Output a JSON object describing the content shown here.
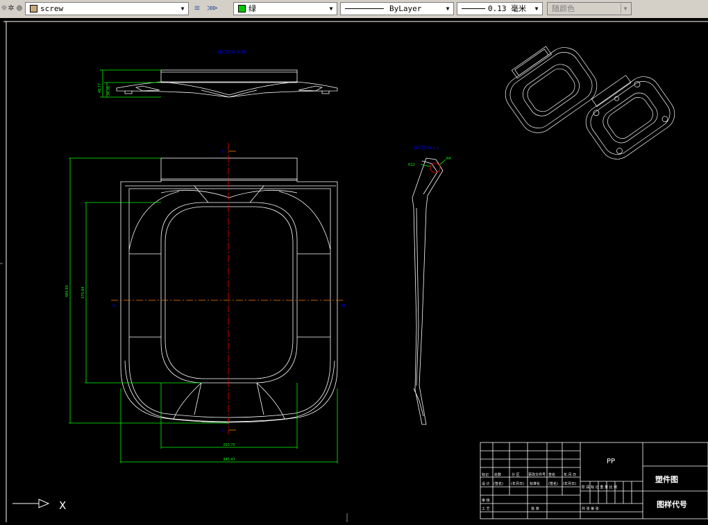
{
  "toolbar": {
    "layer_name": "screw",
    "layer_color_hex": "#c8a878",
    "color_name": "绿",
    "color_swatch_hex": "#00c800",
    "linetype": "ByLayer",
    "lineweight": "0.13 毫米",
    "plotstyle": "随颜色"
  },
  "drawing": {
    "section_mm_label": "SECTION M-M",
    "section_ll_label": "SECTION L-L",
    "dim_48_77": "48.77",
    "dim_34_36": "34.36",
    "dim_484_90": "484.90",
    "dim_370_84": "370.84",
    "dim_250_75": "250.75",
    "dim_345_47": "345.47",
    "dim_r4": "R4",
    "dim_r12": "R12",
    "marker_l": "L",
    "marker_m": "M",
    "colors": {
      "white": "#ffffff",
      "green": "#00ff00",
      "blue": "#0000ff",
      "red": "#ff0000",
      "orange": "#ff7f00"
    }
  },
  "title_block": {
    "part_name": "PP",
    "drawing_type": "塑件图",
    "drawing_code_label": "图样代号",
    "small_row1": [
      "标记",
      "处数",
      "分 区",
      "更改文件号",
      "签名",
      "年.月.日"
    ],
    "small_row2": [
      "设 计",
      "(签名)",
      "(年月日)",
      "标准化",
      "(签名)",
      "(年月日)"
    ],
    "small_row3": [
      "审 核",
      "工 艺"
    ],
    "stage_labels": "阶 段 标 记 重 量 比 例",
    "approve_label": "批 准",
    "pages_label": "共 张 第 张"
  },
  "ucs": {
    "x_label": "X"
  }
}
